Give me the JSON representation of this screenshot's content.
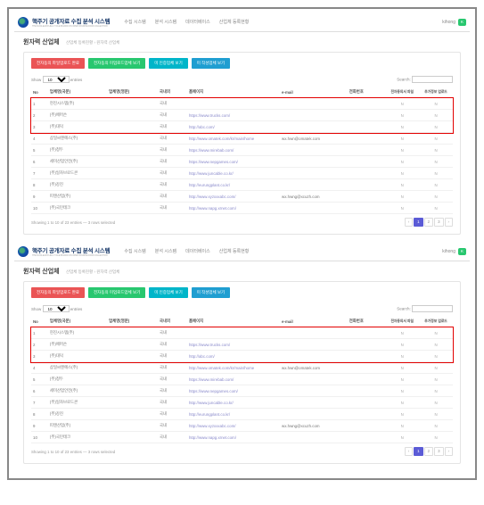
{
  "app": {
    "title_main": "핵주기 공개자료 수집 분석 시스템",
    "title_sub": "THE NUCLEAR FUEL CYCLE BOARD ON OPEN SOURCE DATA COLLECTION",
    "user_name": "kihong",
    "user_badge": "K"
  },
  "nav": [
    "수집 시스템",
    "분석 시스템",
    "데이터베이스",
    "산업체 등록현황"
  ],
  "breadcrumb": {
    "title": "원자력 산업체",
    "path": "산업체 등록현황 › 원자력 산업체"
  },
  "buttons": {
    "b1": "전자동의 파일업로드 완료",
    "b2": "전자동의 미업로드업체 보기",
    "b3": "미 인증업체 보기",
    "b4": "미 작성업체 보기"
  },
  "table": {
    "show": "Show",
    "entries_label": "entries",
    "entries_value": "10",
    "search_label": "Search:",
    "headers": {
      "no": "No",
      "c1": "업체명(국문)",
      "c2": "업체명(영문)",
      "c3": "국내외",
      "hp": "홈페이지",
      "em": "e-mail",
      "tel": "전화번호",
      "a": "전자동의서 파일",
      "b": "추가정보 업로드"
    },
    "rows": [
      {
        "no": "1",
        "c1": "현진시스템(주)",
        "c2": "",
        "c3": "국내",
        "hp": "",
        "em": "",
        "tel": "",
        "a": "N",
        "b": "N"
      },
      {
        "no": "2",
        "c1": "(주)에머슨",
        "c2": "",
        "c3": "국내",
        "hp": "https://www.trucks.com/",
        "em": "",
        "tel": "",
        "a": "N",
        "b": "N"
      },
      {
        "no": "3",
        "c1": "(주)대덕",
        "c2": "",
        "c3": "국내",
        "hp": "http://abc.com/",
        "em": "",
        "tel": "",
        "a": "N",
        "b": "N"
      },
      {
        "no": "4",
        "c1": "삼일씨엔에스(주)",
        "c2": "",
        "c3": "국내",
        "hp": "http://www.omatek.com/kr/main/home",
        "em": "wx.hwn@omatek.com",
        "tel": "",
        "a": "N",
        "b": "N"
      },
      {
        "no": "5",
        "c1": "(주)청두",
        "c2": "",
        "c3": "국내",
        "hp": "https://www.mirebab.com/",
        "em": "",
        "tel": "",
        "a": "N",
        "b": "N"
      },
      {
        "no": "6",
        "c1": "세미산업안전(주)",
        "c2": "",
        "c3": "국내",
        "hp": "https://www.nepgames.com/",
        "em": "",
        "tel": "",
        "a": "N",
        "b": "N"
      },
      {
        "no": "7",
        "c1": "(주)일자브로드콘",
        "c2": "",
        "c3": "국내",
        "hp": "http://www.juncable.co.kr/",
        "em": "",
        "tel": "",
        "a": "N",
        "b": "N"
      },
      {
        "no": "8",
        "c1": "(주)강진",
        "c2": "",
        "c3": "국내",
        "hp": "http://eurungplant.co.kr/",
        "em": "",
        "tel": "",
        "a": "N",
        "b": "N"
      },
      {
        "no": "9",
        "c1": "피앤산업(주)",
        "c2": "",
        "c3": "국내",
        "hp": "http://www.xyzxxxabc.com/",
        "em": "wx.hwng@xcuzh.com",
        "tel": "",
        "a": "N",
        "b": "N"
      },
      {
        "no": "10",
        "c1": "(주)국민테크",
        "c2": "",
        "c3": "국내",
        "hp": "http://www.napg.xrnet.com/",
        "em": "",
        "tel": "",
        "a": "N",
        "b": "N"
      }
    ],
    "footer_info": "Showing 1 to 10 of 23 entries — 3 rows selected",
    "pager": {
      "prev": "‹",
      "cur": "1",
      "p2": "2",
      "p3": "3",
      "next": "›"
    }
  }
}
